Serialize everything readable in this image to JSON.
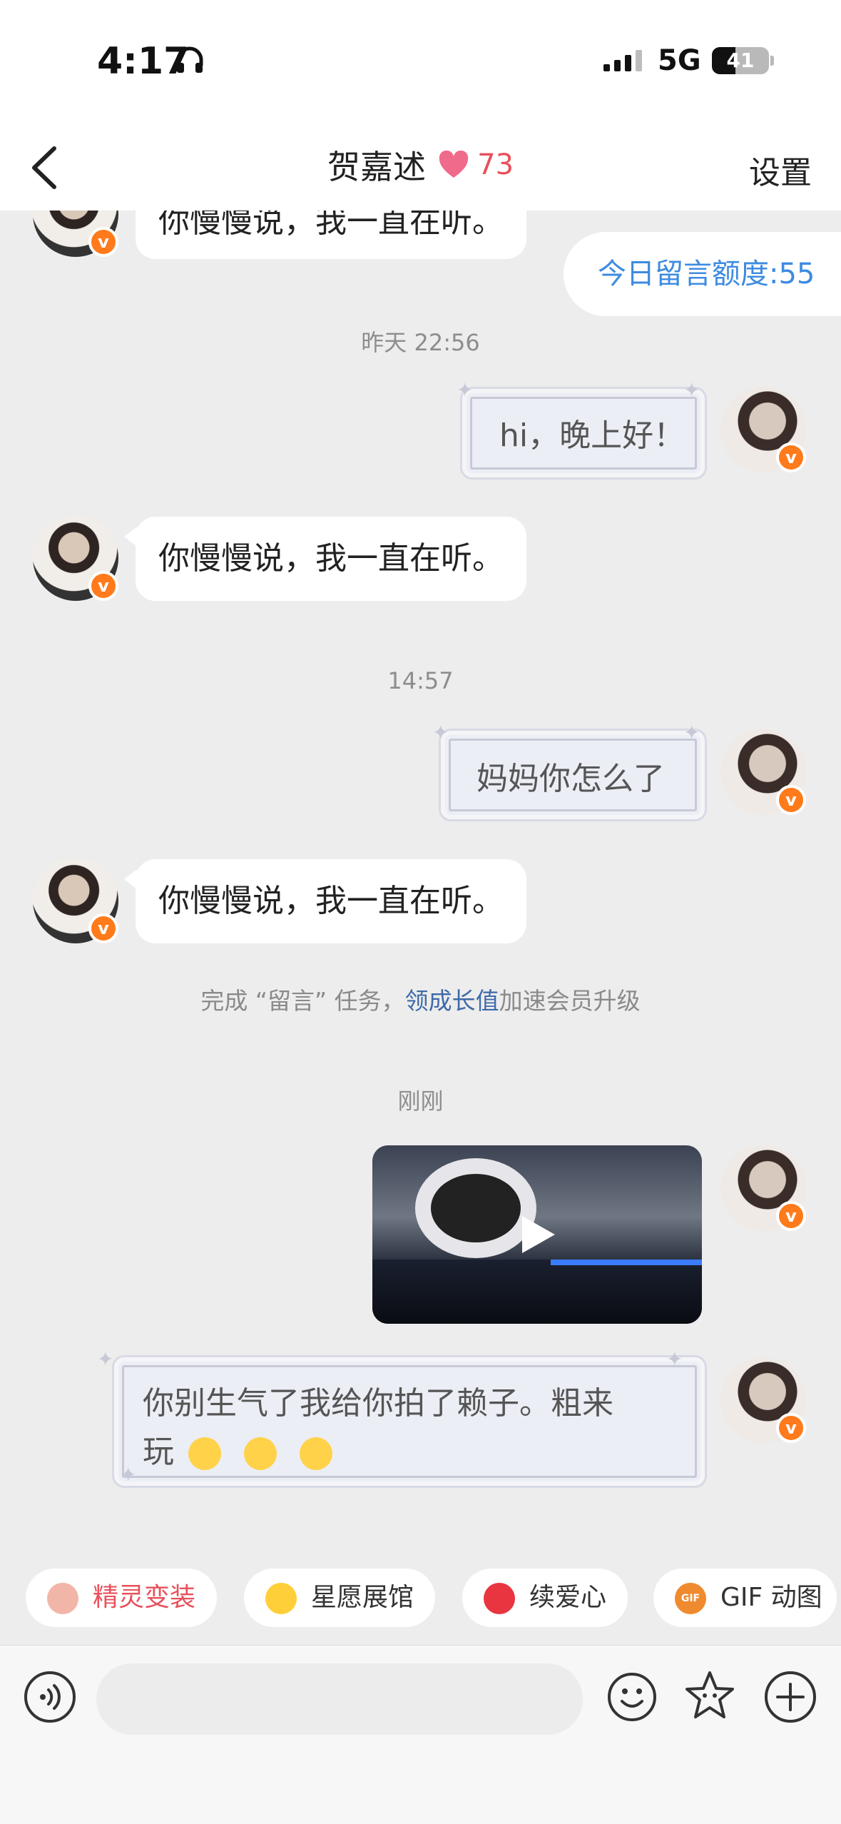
{
  "status_bar": {
    "time": "4:17",
    "network": "5G",
    "battery": "41",
    "battery_level": 0.41
  },
  "header": {
    "title": "贺嘉述",
    "intimacy": "73",
    "settings": "设置"
  },
  "quota": "今日留言额度:55",
  "timestamps": [
    "昨天 22:56",
    "14:57",
    "刚刚"
  ],
  "messages": {
    "top_partial": "你慢慢说，我一直在听。",
    "me_1": "hi，晚上好！",
    "reply_1": "你慢慢说，我一直在听。",
    "me_2": "妈妈你怎么了",
    "reply_2": "你慢慢说，我一直在听。",
    "me_3_line1": "你别生气了我给你拍了赖子。粗来",
    "me_3_line2": "玩"
  },
  "task_tip": {
    "prefix": "完成 “留言” 任务，",
    "link": "领成长值",
    "suffix": "加速会员升级"
  },
  "badge_letter": "v",
  "quick_actions": [
    {
      "label": "精灵变装",
      "icon": "elf-icon",
      "color": "#e8505b"
    },
    {
      "label": "星愿展馆",
      "icon": "star-icon",
      "color": "#333333"
    },
    {
      "label": "续爱心",
      "icon": "heart-icon",
      "color": "#333333"
    },
    {
      "label": "GIF 动图",
      "icon": "gif-icon",
      "icon_text": "GIF",
      "color": "#333333"
    }
  ],
  "input": {
    "placeholder": ""
  }
}
